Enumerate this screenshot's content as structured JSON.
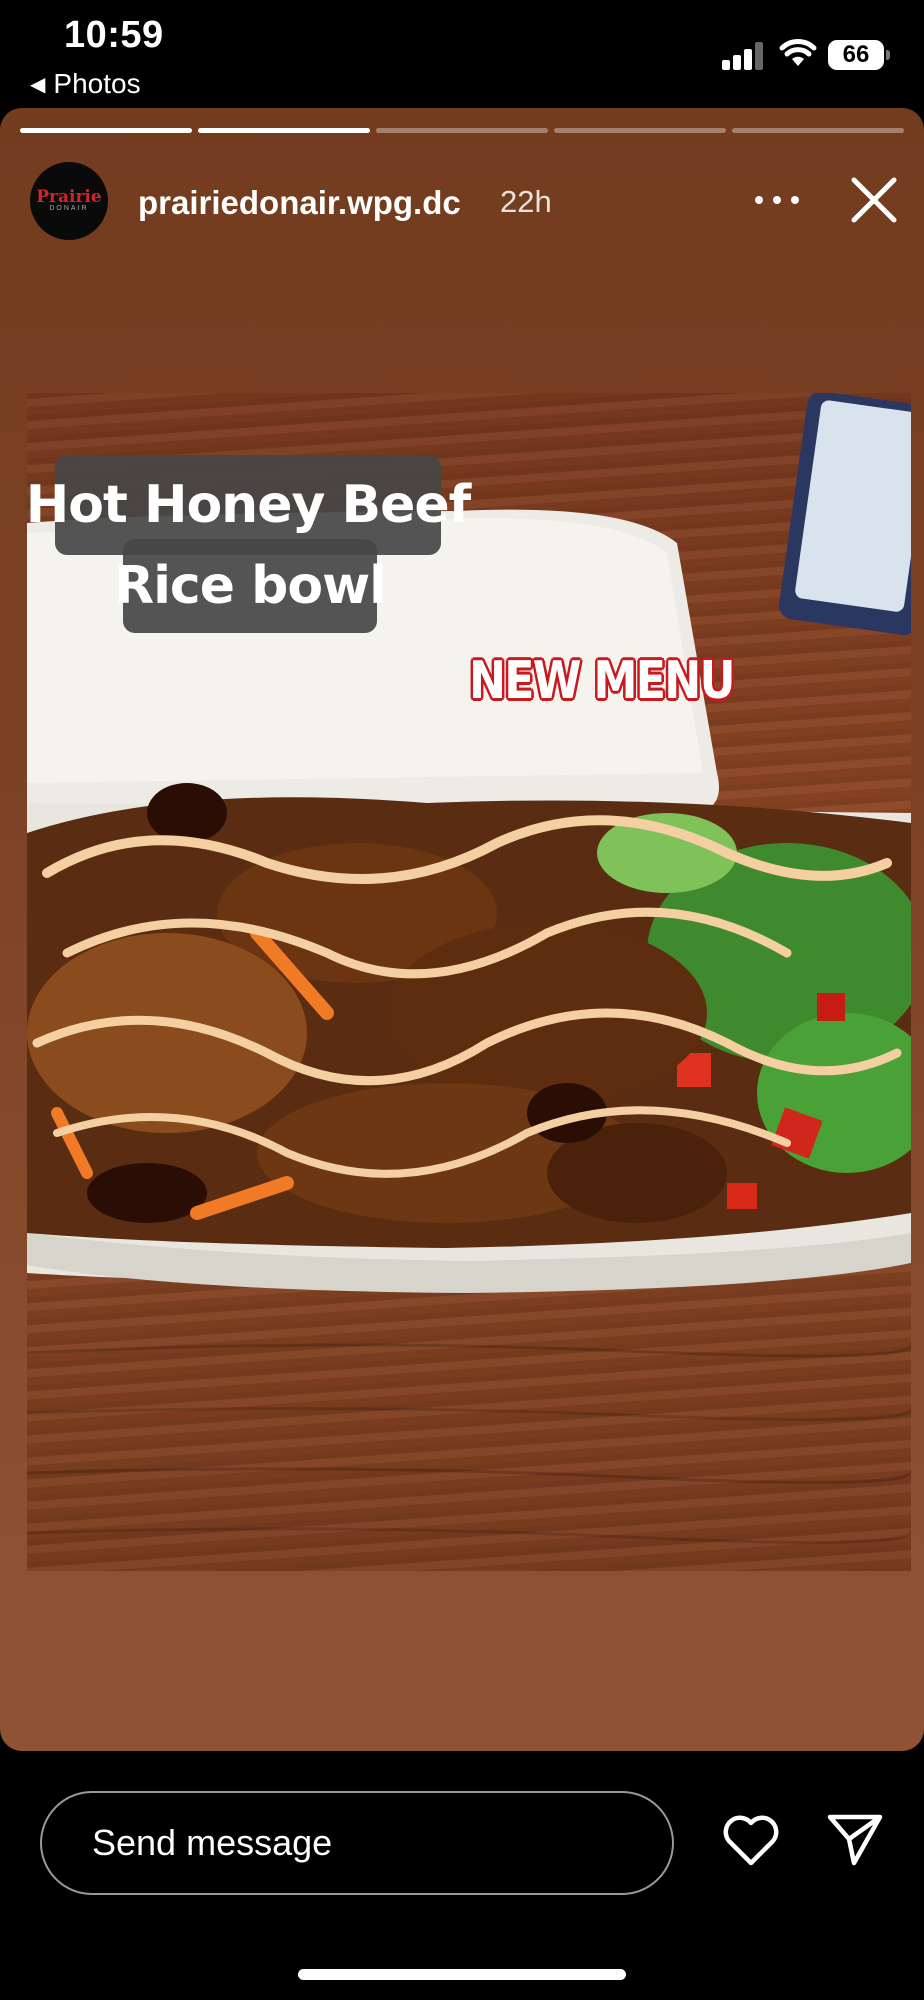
{
  "status_bar": {
    "time": "10:59",
    "back_label": "Photos",
    "battery": "66"
  },
  "story": {
    "progress": [
      1,
      1,
      0,
      0,
      0
    ],
    "username": "prairiedonair.wpg.dc",
    "time_ago": "22h",
    "avatar_logo_text": [
      "Prairie",
      "DONAIR"
    ],
    "caption_line1": "Hot Honey Beef",
    "caption_line2": "Rice bowl",
    "sticker": "NEW MENU"
  },
  "bottom_bar": {
    "message_placeholder": "Send message"
  },
  "colors": {
    "story_bg": "#7c4226",
    "sticker_outline": "#c8191e",
    "logo_red": "#d8222a"
  },
  "icons": [
    "back-triangle-icon",
    "signal-icon",
    "wifi-icon",
    "battery-icon",
    "more-icon",
    "close-icon",
    "heart-icon",
    "send-icon"
  ]
}
